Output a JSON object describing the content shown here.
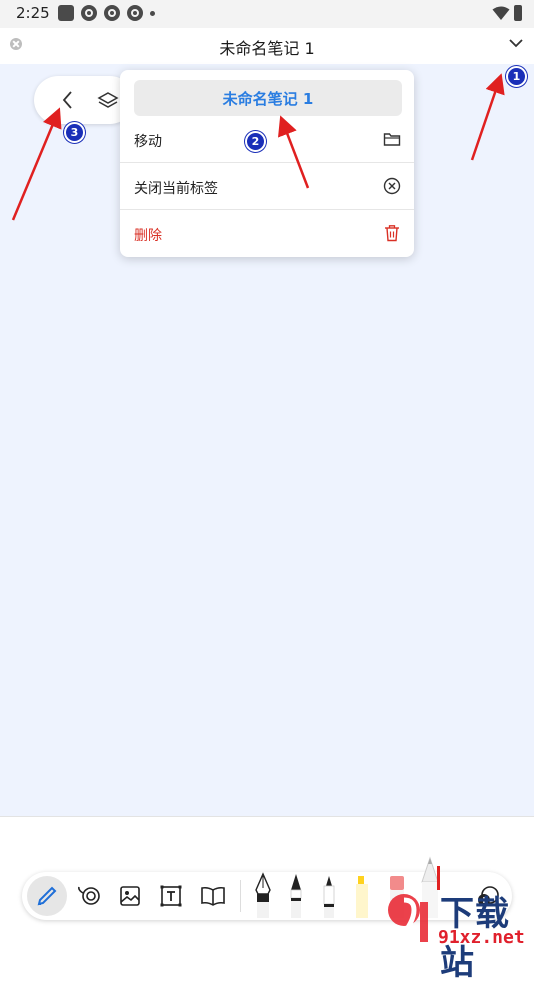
{
  "status_bar": {
    "time": "2:25"
  },
  "header": {
    "title": "未命名笔记 1"
  },
  "menu": {
    "title": "未命名笔记 1",
    "items": [
      {
        "label": "移动",
        "icon": "folder-icon"
      },
      {
        "label": "关闭当前标签",
        "icon": "close-circle-icon"
      },
      {
        "label": "删除",
        "icon": "trash-icon",
        "color": "#d93025"
      }
    ]
  },
  "markers": [
    "1",
    "2",
    "3"
  ],
  "toolbar": {
    "tools": [
      "pen-icon",
      "lasso-icon",
      "image-icon",
      "text-box-icon",
      "book-icon",
      "fountain-pen-icon",
      "ballpoint-pen-icon",
      "marker-pen-icon",
      "highlighter-icon",
      "eraser-icon",
      "pencil-icon",
      "add-tool-icon"
    ]
  },
  "watermark": {
    "main": "下载站",
    "url": "91xz.net"
  },
  "colors": {
    "accent": "#2a7de1",
    "danger": "#d93025",
    "canvas": "#eef3fe",
    "annotation_arrow": "#e02020",
    "marker": "#1a2fb8"
  }
}
